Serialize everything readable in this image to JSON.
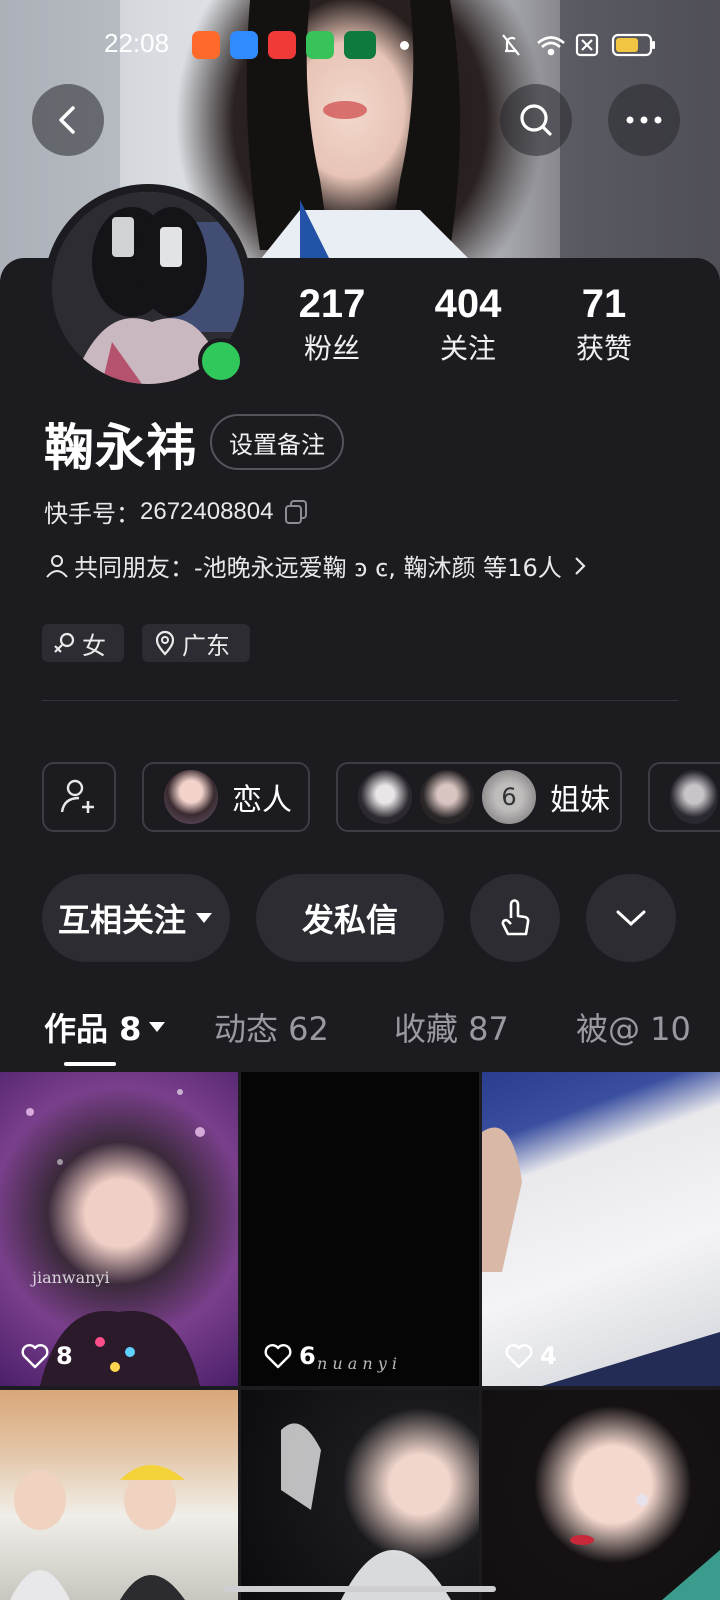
{
  "status_bar": {
    "time": "22:08"
  },
  "profile": {
    "name": "鞠永祎",
    "remark_button": "设置备注",
    "id_label": "快手号：",
    "id_value": "2672408804",
    "mutual_label": "共同朋友：",
    "mutual_value": "-池晚永远爱鞠 ͽ ͼ, 鞠沐颜 等16人",
    "gender_tag": "女",
    "location_tag": "广东"
  },
  "stats": [
    {
      "value": "217",
      "label": "粉丝"
    },
    {
      "value": "404",
      "label": "关注"
    },
    {
      "value": "71",
      "label": "获赞"
    }
  ],
  "relations": [
    {
      "label": "恋人"
    },
    {
      "label": "姐妹",
      "avatar_badge": "6"
    }
  ],
  "actions": {
    "follow_label": "互相关注",
    "message_label": "发私信"
  },
  "tabs": [
    {
      "label": "作品 8"
    },
    {
      "label": "动态 62"
    },
    {
      "label": "收藏 87"
    },
    {
      "label": "被@ 10"
    }
  ],
  "grid": [
    {
      "likes": "8",
      "watermark": "jianwanyi"
    },
    {
      "likes": "6",
      "watermark": "n u a n y i"
    },
    {
      "likes": "4",
      "watermark": ""
    },
    {
      "likes": "",
      "watermark": ""
    },
    {
      "likes": "",
      "watermark": ""
    },
    {
      "likes": "",
      "watermark": ""
    }
  ],
  "colors": {
    "online": "#30c85a",
    "background": "#1c1b20",
    "button": "#2d2c32"
  }
}
